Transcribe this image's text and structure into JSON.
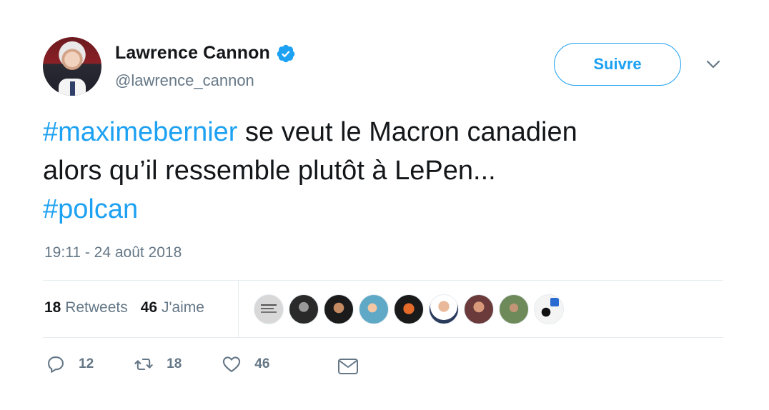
{
  "author": {
    "name": "Lawrence Cannon",
    "handle": "@lawrence_cannon",
    "verified": true
  },
  "follow_button": {
    "label": "Suivre"
  },
  "tweet": {
    "segments_line1": [
      {
        "text": "#maximebernier",
        "type": "hashtag"
      },
      {
        "text": " se veut le Macron canadien",
        "type": "text"
      }
    ],
    "line2": "alors qu’il ressemble plutôt à LePen...",
    "line3_hashtag": "#polcan"
  },
  "timestamp": "19:11 - 24 août 2018",
  "stats": {
    "retweets_count": "18",
    "retweets_label": "Retweets",
    "likes_count": "46",
    "likes_label": "J'aime"
  },
  "likers_count_shown": 9,
  "actions": {
    "reply_count": "12",
    "retweet_count": "18",
    "like_count": "46"
  },
  "colors": {
    "accent": "#1da1f2",
    "muted": "#657786",
    "text": "#14171a",
    "divider": "#e6ecf0"
  },
  "icons": [
    "verified-badge-icon",
    "chevron-down-icon",
    "reply-icon",
    "retweet-icon",
    "heart-icon",
    "mail-icon"
  ]
}
